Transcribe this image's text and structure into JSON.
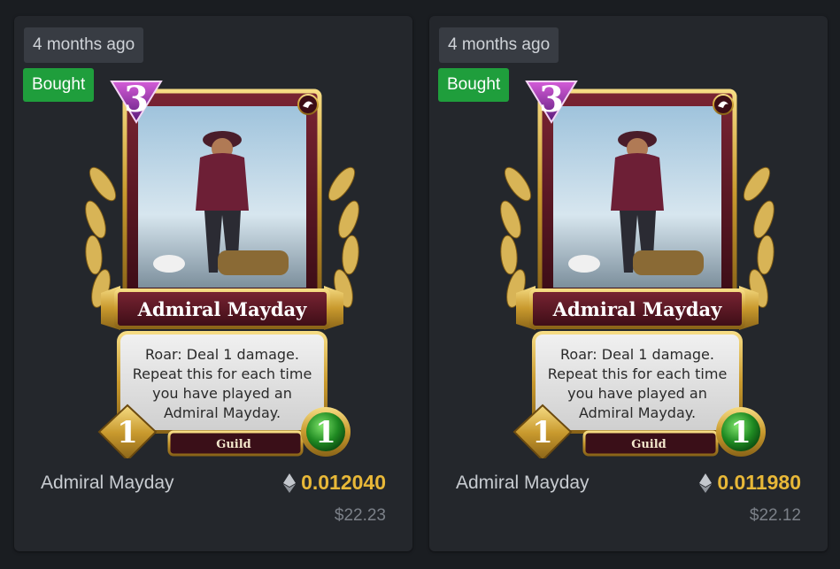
{
  "listings": [
    {
      "age": "4 months ago",
      "status": "Bought",
      "card": {
        "name": "Admiral Mayday",
        "text_lines": [
          "Roar: Deal 1 damage.",
          "Repeat this for each time",
          "you have played an",
          "Admiral Mayday."
        ],
        "tribe": "Guild",
        "mana": "1",
        "attack": "1",
        "tier": "3"
      },
      "title": "Admiral Mayday",
      "price_eth": "0.012040",
      "price_usd": "$22.23"
    },
    {
      "age": "4 months ago",
      "status": "Bought",
      "card": {
        "name": "Admiral Mayday",
        "text_lines": [
          "Roar: Deal 1 damage.",
          "Repeat this for each time",
          "you have played an",
          "Admiral Mayday."
        ],
        "tribe": "Guild",
        "mana": "1",
        "attack": "1",
        "tier": "3"
      },
      "title": "Admiral Mayday",
      "price_eth": "0.011980",
      "price_usd": "$22.12"
    }
  ],
  "colors": {
    "background": "#1a1d21",
    "panel": "#24272c",
    "bought_badge": "#1f9e3c",
    "eth_price": "#e8b838",
    "usd_price": "#7b8088"
  },
  "icons": [
    "eth-icon",
    "guild-emblem-icon",
    "mana-gem-icon",
    "attack-gem-icon",
    "tier-badge-icon"
  ]
}
